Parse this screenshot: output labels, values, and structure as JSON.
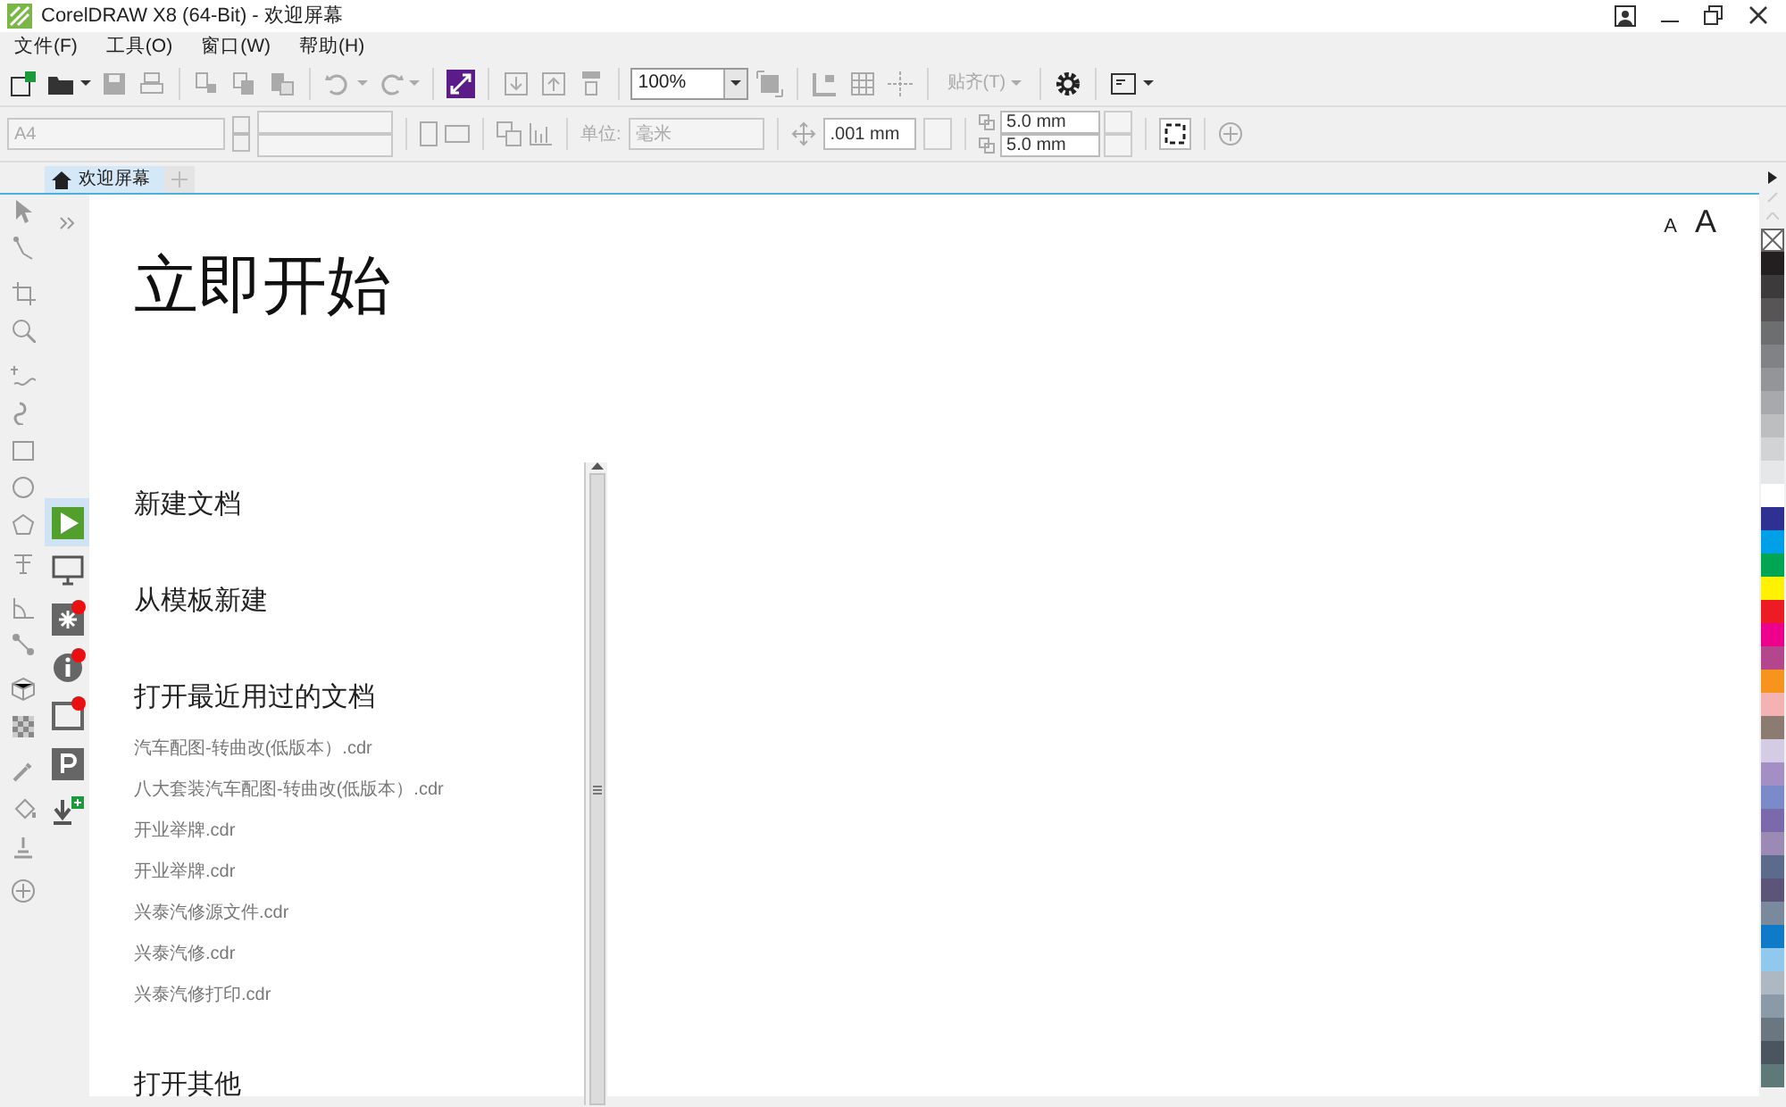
{
  "window": {
    "title": "CorelDRAW X8 (64-Bit) - 欢迎屏幕"
  },
  "menu": [
    "文件(F)",
    "工具(O)",
    "窗口(W)",
    "帮助(H)"
  ],
  "toolbar": [
    {
      "kind": "new",
      "disabled": false
    },
    {
      "kind": "open",
      "disabled": false
    },
    {
      "kind": "save",
      "disabled": true
    },
    {
      "kind": "print",
      "disabled": true
    },
    {
      "kind": "sep"
    },
    {
      "kind": "cut",
      "disabled": true
    },
    {
      "kind": "copy",
      "disabled": true
    },
    {
      "kind": "paste",
      "disabled": true
    },
    {
      "kind": "sep"
    },
    {
      "kind": "undo",
      "disabled": true
    },
    {
      "kind": "redo",
      "disabled": true
    },
    {
      "kind": "sep"
    },
    {
      "kind": "launch",
      "disabled": false
    },
    {
      "kind": "sep"
    },
    {
      "kind": "import",
      "disabled": true
    },
    {
      "kind": "export",
      "disabled": true
    },
    {
      "kind": "pdf",
      "disabled": true
    },
    {
      "kind": "sep"
    },
    {
      "kind": "zoom",
      "value": "100%"
    },
    {
      "kind": "fullscreen",
      "disabled": true
    },
    {
      "kind": "sep"
    },
    {
      "kind": "rulers",
      "disabled": true
    },
    {
      "kind": "grid",
      "disabled": true
    },
    {
      "kind": "guides",
      "disabled": true
    },
    {
      "kind": "sep"
    },
    {
      "kind": "snap",
      "label": "贴齐(T)",
      "disabled": true
    },
    {
      "kind": "sep"
    },
    {
      "kind": "options",
      "disabled": false
    },
    {
      "kind": "sep"
    },
    {
      "kind": "layout",
      "disabled": false
    }
  ],
  "property_bar": {
    "page_size": "A4",
    "unit_label": "单位:",
    "unit": "毫米",
    "nudge": ".001 mm",
    "duplicate_x": "5.0 mm",
    "duplicate_y": "5.0 mm"
  },
  "tab": {
    "label": "欢迎屏幕",
    "selected": true
  },
  "toolbox": [
    {
      "kind": "pick"
    },
    {
      "kind": "freehand-pick"
    },
    {
      "kind": "crop"
    },
    {
      "kind": "zoom"
    },
    {
      "kind": "freehand"
    },
    {
      "kind": "artistic"
    },
    {
      "kind": "rectangle"
    },
    {
      "kind": "ellipse"
    },
    {
      "kind": "polygon"
    },
    {
      "kind": "text"
    },
    {
      "kind": "dimension"
    },
    {
      "kind": "connector"
    },
    {
      "kind": "extrude"
    },
    {
      "kind": "transparency"
    },
    {
      "kind": "eyedropper"
    },
    {
      "kind": "fill"
    },
    {
      "kind": "smart-fill"
    },
    {
      "kind": "add"
    }
  ],
  "side_panel": [
    {
      "kind": "play",
      "selected": true,
      "badge": false
    },
    {
      "kind": "monitor",
      "selected": false,
      "badge": false
    },
    {
      "kind": "star",
      "selected": false,
      "badge": true
    },
    {
      "kind": "info",
      "selected": false,
      "badge": true
    },
    {
      "kind": "frame",
      "selected": false,
      "badge": true
    },
    {
      "kind": "parking",
      "selected": false,
      "badge": false
    },
    {
      "kind": "download",
      "selected": false,
      "badge": false
    }
  ],
  "font_size_buttons": [
    "A",
    "A"
  ],
  "heading": "立即开始",
  "sections": [
    {
      "title": "新建文档"
    },
    {
      "title": "从模板新建"
    },
    {
      "title": "打开最近用过的文档",
      "files": [
        "汽车配图-转曲改(低版本）.cdr",
        "八大套装汽车配图-转曲改(低版本）.cdr",
        "开业举牌.cdr",
        "开业举牌.cdr",
        "兴泰汽修源文件.cdr",
        "兴泰汽修.cdr",
        "兴泰汽修打印.cdr"
      ]
    },
    {
      "title": "打开其他"
    }
  ],
  "palette": {
    "swatches": [
      {
        "color": "#231f20"
      },
      {
        "color": "#3d3a3b"
      },
      {
        "color": "#575556"
      },
      {
        "color": "#6d6e70"
      },
      {
        "color": "#808285"
      },
      {
        "color": "#939598"
      },
      {
        "color": "#a7a9ac"
      },
      {
        "color": "#bcbec0"
      },
      {
        "color": "#d1d3d4"
      },
      {
        "color": "#e6e7e8"
      },
      {
        "color": "#ffffff"
      },
      {
        "color": "#2e3192"
      },
      {
        "color": "#00a0e9"
      },
      {
        "color": "#00a651"
      },
      {
        "color": "#fff200"
      },
      {
        "color": "#ed1c24"
      },
      {
        "color": "#ec008c"
      },
      {
        "color": "#b3468c"
      },
      {
        "color": "#f7941d"
      },
      {
        "color": "#f5b2b2"
      },
      {
        "color": "#8c7b70"
      },
      {
        "color": "#d4cbe5"
      },
      {
        "color": "#a38fc4"
      },
      {
        "color": "#7b8ac8"
      },
      {
        "color": "#7a6aac"
      },
      {
        "color": "#9b8bb4"
      },
      {
        "color": "#5a6b8c"
      },
      {
        "color": "#5c5577"
      },
      {
        "color": "#7a8a9c"
      },
      {
        "color": "#0f7ac8"
      },
      {
        "color": "#90c8ee"
      },
      {
        "color": "#aeb8c2"
      },
      {
        "color": "#8a9aa6"
      },
      {
        "color": "#6a7680"
      },
      {
        "color": "#4a5560"
      },
      {
        "color": "#5e7a78"
      }
    ]
  }
}
